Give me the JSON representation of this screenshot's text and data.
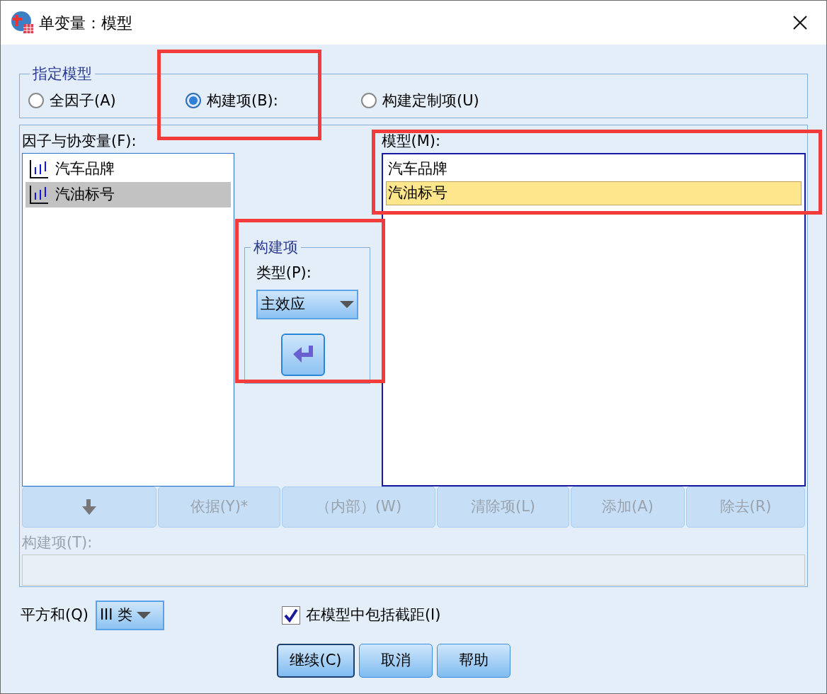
{
  "window": {
    "title": "单变量：模型"
  },
  "specify_model": {
    "legend": "指定模型",
    "options": [
      {
        "label": "全因子(A)",
        "selected": false
      },
      {
        "label": "构建项(B):",
        "selected": true
      },
      {
        "label": "构建定制项(U)",
        "selected": false
      }
    ]
  },
  "factors": {
    "label": "因子与协变量(F):",
    "items": [
      {
        "label": "汽车品牌",
        "selected": false
      },
      {
        "label": "汽油标号",
        "selected": true
      }
    ]
  },
  "build_term": {
    "legend": "构建项",
    "type_label": "类型(P):",
    "type_value": "主效应"
  },
  "model": {
    "label": "模型(M):",
    "items": [
      {
        "label": "汽车品牌",
        "selected": false
      },
      {
        "label": "汽油标号",
        "selected": true
      }
    ]
  },
  "term_buttons": [
    {
      "kind": "arrow",
      "disabled": true
    },
    {
      "kind": "text",
      "label": "依据(Y)*",
      "disabled": true
    },
    {
      "kind": "text",
      "label": "（内部）(W)",
      "disabled": true
    },
    {
      "kind": "text",
      "label": "清除项(L)",
      "disabled": true
    },
    {
      "kind": "text",
      "label": "添加(A)",
      "disabled": true
    },
    {
      "kind": "text",
      "label": "除去(R)",
      "disabled": true
    }
  ],
  "term_field": {
    "label": "构建项(T):",
    "disabled": true
  },
  "sum_of_squares": {
    "label": "平方和(Q)",
    "value": "III 类"
  },
  "include_intercept": {
    "label": "在模型中包括截距(I)",
    "checked": true
  },
  "buttons": [
    {
      "label": "继续(C)",
      "default": true
    },
    {
      "label": "取消",
      "default": false
    },
    {
      "label": "帮助",
      "default": false
    }
  ]
}
